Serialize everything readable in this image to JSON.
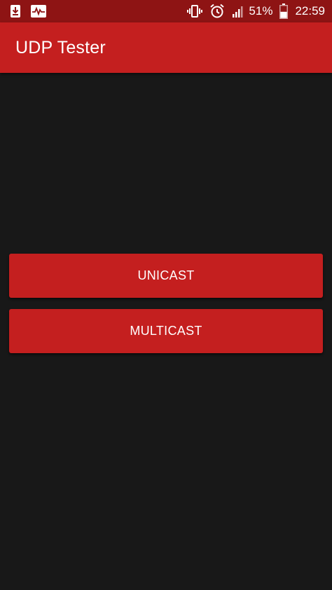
{
  "status_bar": {
    "left_icons": [
      "download-notification-icon",
      "activity-monitor-icon"
    ],
    "right_icons": [
      "vibrate-icon",
      "alarm-icon",
      "signal-icon",
      "battery-icon"
    ],
    "battery_percent": "51%",
    "battery_level": 0.51,
    "time": "22:59"
  },
  "app_bar": {
    "title": "UDP Tester"
  },
  "buttons": {
    "unicast_label": "UNICAST",
    "multicast_label": "MULTICAST"
  },
  "colors": {
    "status_bar": "#8e1414",
    "primary": "#c41f1f",
    "background": "#181818",
    "text": "#ffffff"
  }
}
